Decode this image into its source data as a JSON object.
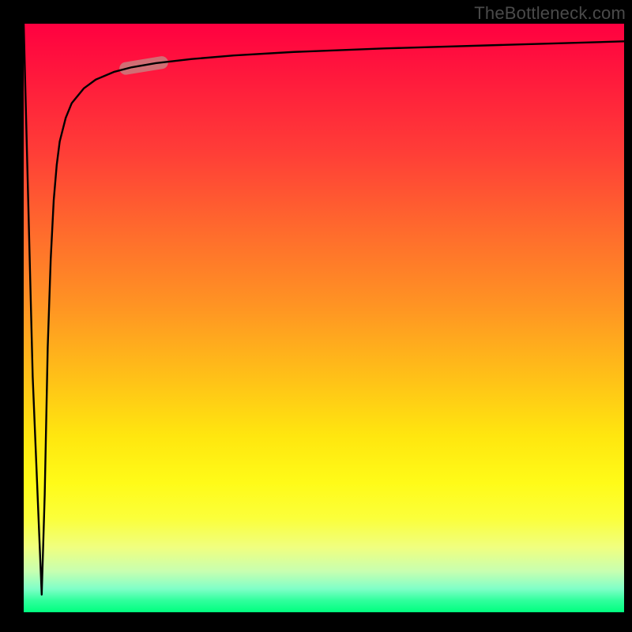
{
  "attribution": "TheBottleneck.com",
  "colors": {
    "frame": "#000000",
    "curve": "#000000",
    "highlight": "#c97e7e",
    "gradient_top": "#ff0040",
    "gradient_bottom": "#00ff80"
  },
  "chart_data": {
    "type": "line",
    "title": "",
    "xlabel": "",
    "ylabel": "",
    "xlim": [
      0,
      100
    ],
    "ylim": [
      0,
      100
    ],
    "series": [
      {
        "name": "curve",
        "x": [
          0.0,
          1.5,
          3.0,
          3.5,
          4.0,
          4.5,
          5.0,
          5.5,
          6.0,
          7.0,
          8.0,
          10.0,
          12.0,
          15.0,
          18.0,
          22.0,
          28.0,
          35.0,
          45.0,
          60.0,
          80.0,
          100.0
        ],
        "values": [
          100.0,
          40.0,
          3.0,
          20.0,
          45.0,
          60.0,
          70.0,
          76.0,
          80.0,
          84.0,
          86.5,
          89.0,
          90.5,
          91.8,
          92.6,
          93.3,
          94.0,
          94.6,
          95.2,
          95.8,
          96.4,
          97.0
        ]
      }
    ],
    "highlight_segment": {
      "x_start": 17.0,
      "x_end": 23.0,
      "y_start": 92.4,
      "y_end": 93.4
    }
  }
}
